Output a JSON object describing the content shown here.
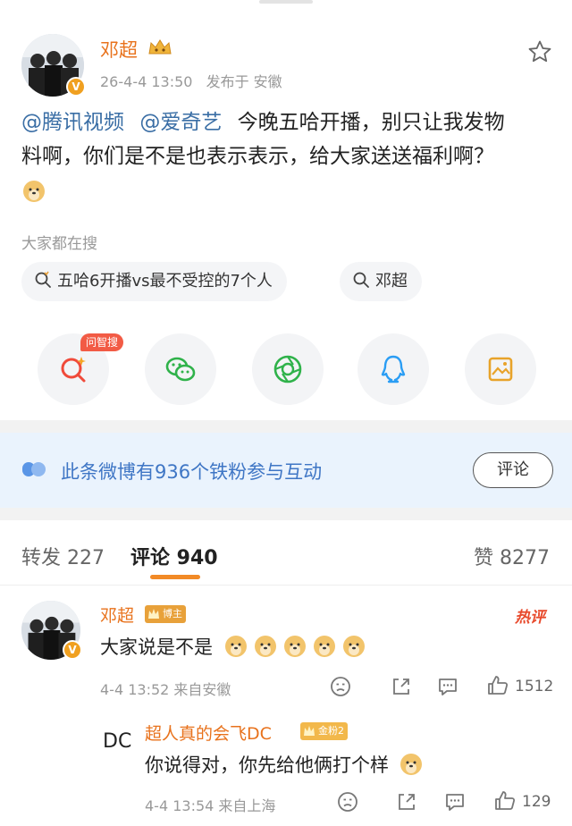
{
  "post": {
    "author": "邓超",
    "time": "26-4-4 13:50",
    "location_text": "发布于 安徽",
    "mentions": [
      "@腾讯视频",
      "@爱奇艺"
    ],
    "body_line1": "今晚五哈开播，别只让我发物",
    "body_line2": "料啊，你们是不是也表示表示，给大家送送福利啊？"
  },
  "search": {
    "title": "大家都在搜",
    "chips": [
      "五哈6开播vs最不受控的7个人",
      "邓超"
    ]
  },
  "share": {
    "ai_tag": "问智搜",
    "icons": [
      "ai-search-icon",
      "wechat-icon",
      "moments-icon",
      "qq-icon",
      "save-image-icon"
    ]
  },
  "fans": {
    "text": "此条微博有936个铁粉参与互动",
    "button": "评论"
  },
  "tabs": {
    "repost": "转发 227",
    "comment": "评论 940",
    "like": "赞 8277"
  },
  "comments": [
    {
      "name": "邓超",
      "badge": "博主",
      "hot": "热评",
      "text": "大家说是不是",
      "emoji_count": 5,
      "meta": "4-4 13:52  来自安徽",
      "likes": "1512"
    },
    {
      "name": "超人真的会飞DC",
      "badge": "金粉2",
      "text": "你说得对，你先给他俩打个样",
      "meta": "4-4 13:54  来自上海",
      "likes": "129"
    }
  ],
  "colors": {
    "name_orange": "#e8721c",
    "link_blue": "#3a6ea5",
    "fans_bg": "#eaf3fd",
    "tab_accent": "#f28a26"
  }
}
